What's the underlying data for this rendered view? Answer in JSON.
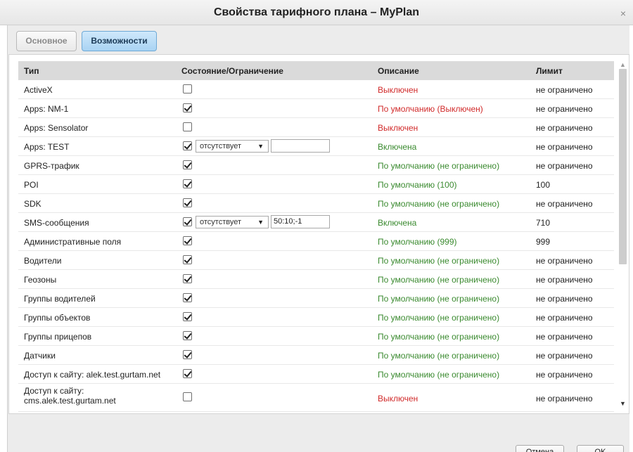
{
  "window": {
    "title": "Свойства тарифного плана – MyPlan",
    "close_icon": "×"
  },
  "tabs": [
    {
      "label": "Основное",
      "active": false
    },
    {
      "label": "Возможности",
      "active": true
    }
  ],
  "table": {
    "columns": [
      "Тип",
      "Состояние/Ограничение",
      "Описание",
      "Лимит"
    ],
    "rows": [
      {
        "type": "ActiveX",
        "checked": false,
        "description": "Выключен",
        "desc_color": "red",
        "limit": "не ограничено"
      },
      {
        "type": "Apps: NM-1",
        "checked": true,
        "description": "По умолчанию (Выключен)",
        "desc_color": "red",
        "limit": "не ограничено"
      },
      {
        "type": "Apps: Sensolator",
        "checked": false,
        "description": "Выключен",
        "desc_color": "red",
        "limit": "не ограничено"
      },
      {
        "type": "Apps: TEST",
        "checked": true,
        "select": "отсутствует",
        "input": "",
        "description": "Включена",
        "desc_color": "green",
        "limit": "не ограничено"
      },
      {
        "type": "GPRS-трафик",
        "checked": true,
        "description": "По умолчанию (не ограничено)",
        "desc_color": "green",
        "limit": "не ограничено"
      },
      {
        "type": "POI",
        "checked": true,
        "description": "По умолчанию (100)",
        "desc_color": "green",
        "limit": "100"
      },
      {
        "type": "SDK",
        "checked": true,
        "description": "По умолчанию (не ограничено)",
        "desc_color": "green",
        "limit": "не ограничено"
      },
      {
        "type": "SMS-сообщения",
        "checked": true,
        "select": "отсутствует",
        "input": "50:10;-1",
        "description": "Включена",
        "desc_color": "green",
        "limit": "710"
      },
      {
        "type": "Административные поля",
        "checked": true,
        "description": "По умолчанию (999)",
        "desc_color": "green",
        "limit": "999"
      },
      {
        "type": "Водители",
        "checked": true,
        "description": "По умолчанию (не ограничено)",
        "desc_color": "green",
        "limit": "не ограничено"
      },
      {
        "type": "Геозоны",
        "checked": true,
        "description": "По умолчанию (не ограничено)",
        "desc_color": "green",
        "limit": "не ограничено"
      },
      {
        "type": "Группы водителей",
        "checked": true,
        "description": "По умолчанию (не ограничено)",
        "desc_color": "green",
        "limit": "не ограничено"
      },
      {
        "type": "Группы объектов",
        "checked": true,
        "description": "По умолчанию (не ограничено)",
        "desc_color": "green",
        "limit": "не ограничено"
      },
      {
        "type": "Группы прицепов",
        "checked": true,
        "description": "По умолчанию (не ограничено)",
        "desc_color": "green",
        "limit": "не ограничено"
      },
      {
        "type": "Датчики",
        "checked": true,
        "description": "По умолчанию (не ограничено)",
        "desc_color": "green",
        "limit": "не ограничено"
      },
      {
        "type": "Доступ к сайту: alek.test.gurtam.net",
        "checked": true,
        "description": "По умолчанию (не ограничено)",
        "desc_color": "green",
        "limit": "не ограничено"
      },
      {
        "type": "Доступ к сайту: cms.alek.test.gurtam.net",
        "checked": false,
        "description": "Выключен",
        "desc_color": "red",
        "limit": "не ограничено"
      }
    ]
  },
  "buttons": {
    "cancel": "Отмена",
    "ok": "OK"
  },
  "colors": {
    "red": "#d12b2b",
    "green": "#3a8a2f",
    "active_tab": "#a9d3f3"
  }
}
